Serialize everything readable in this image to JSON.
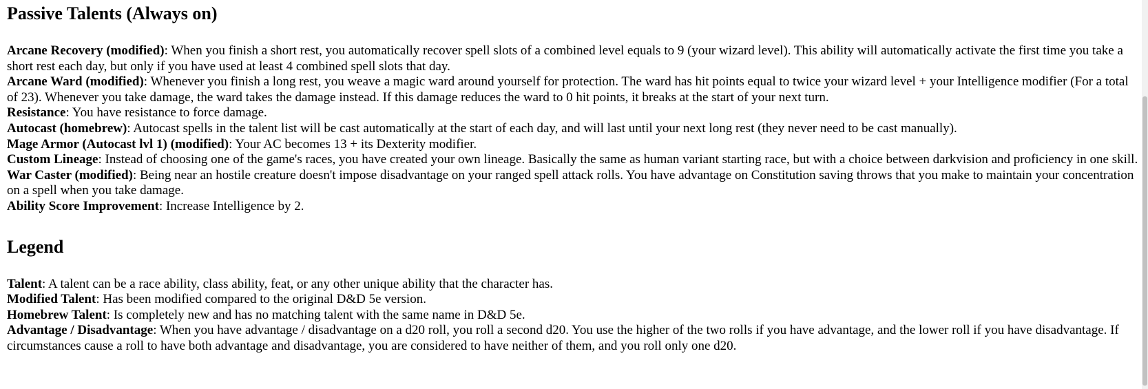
{
  "sections": {
    "passive": {
      "title": "Passive Talents (Always on)",
      "items": [
        {
          "name": "Arcane Recovery (modified)",
          "text": ": When you finish a short rest, you automatically recover spell slots of a combined level equals to 9 (your wizard level). This ability will automatically activate the first time you take a short rest each day, but only if you have used at least 4 combined spell slots that day."
        },
        {
          "name": "Arcane Ward (modified)",
          "text": ": Whenever you finish a long rest, you weave a magic ward around yourself for protection. The ward has hit points equal to twice your wizard level + your Intelligence modifier (For a total of 23). Whenever you take damage, the ward takes the damage instead. If this damage reduces the ward to 0 hit points, it breaks at the start of your next turn."
        },
        {
          "name": "Resistance",
          "text": ": You have resistance to force damage."
        },
        {
          "name": "Autocast (homebrew)",
          "text": ": Autocast spells in the talent list will be cast automatically at the start of each day, and will last until your next long rest (they never need to be cast manually)."
        },
        {
          "name": "Mage Armor (Autocast lvl 1) (modified)",
          "text": ": Your AC becomes 13 + its Dexterity modifier."
        },
        {
          "name": "Custom Lineage",
          "text": ": Instead of choosing one of the game's races, you have created your own lineage. Basically the same as human variant starting race, but with a choice between darkvision and proficiency in one skill."
        },
        {
          "name": "War Caster (modified)",
          "text": ": Being near an hostile creature doesn't impose disadvantage on your ranged spell attack rolls. You have advantage on Constitution saving throws that you make to maintain your concentration on a spell when you take damage."
        },
        {
          "name": "Ability Score Improvement",
          "text": ": Increase Intelligence by 2."
        }
      ]
    },
    "legend": {
      "title": "Legend",
      "items": [
        {
          "name": "Talent",
          "text": ": A talent can be a race ability, class ability, feat, or any other unique ability that the character has."
        },
        {
          "name": "Modified Talent",
          "text": ": Has been modified compared to the original D&D 5e version."
        },
        {
          "name": "Homebrew Talent",
          "text": ": Is completely new and has no matching talent with the same name in D&D 5e."
        },
        {
          "name": "Advantage / Disadvantage",
          "text": ": When you have advantage / disadvantage on a d20 roll, you roll a second d20. You use the higher of the two rolls if you have advantage, and the lower roll if you have disadvantage. If circumstances cause a roll to have both advantage and disadvantage, you are considered to have neither of them, and you roll only one d20."
        }
      ]
    }
  }
}
